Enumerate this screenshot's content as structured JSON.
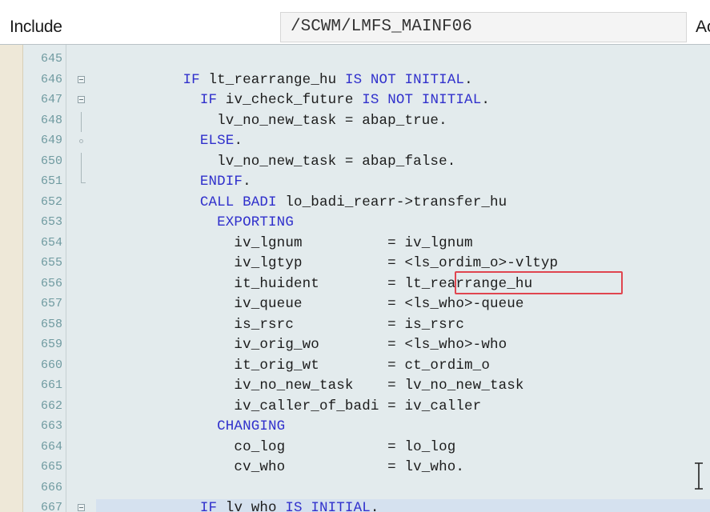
{
  "header": {
    "include_label": "Include",
    "include_value": "/SCWM/LMFS_MAINF06",
    "right_label": "Ac"
  },
  "editor": {
    "lines": [
      {
        "num": "645",
        "segs": []
      },
      {
        "num": "646",
        "fold": "box",
        "segs": [
          {
            "t": "          "
          },
          {
            "t": "IF",
            "k": 1
          },
          {
            "t": " lt_rearrange_hu "
          },
          {
            "t": "IS NOT INITIAL",
            "k": 1
          },
          {
            "t": "."
          }
        ]
      },
      {
        "num": "647",
        "fold": "box",
        "segs": [
          {
            "t": "            "
          },
          {
            "t": "IF",
            "k": 1
          },
          {
            "t": " iv_check_future "
          },
          {
            "t": "IS NOT INITIAL",
            "k": 1
          },
          {
            "t": "."
          }
        ]
      },
      {
        "num": "648",
        "fold": "line",
        "segs": [
          {
            "t": "              lv_no_new_task = abap_true."
          }
        ]
      },
      {
        "num": "649",
        "fold": "dot",
        "segs": [
          {
            "t": "            "
          },
          {
            "t": "ELSE",
            "k": 1
          },
          {
            "t": "."
          }
        ]
      },
      {
        "num": "650",
        "fold": "line",
        "segs": [
          {
            "t": "              lv_no_new_task = abap_false."
          }
        ]
      },
      {
        "num": "651",
        "fold": "end",
        "segs": [
          {
            "t": "            "
          },
          {
            "t": "ENDIF",
            "k": 1
          },
          {
            "t": "."
          }
        ]
      },
      {
        "num": "652",
        "segs": [
          {
            "t": "            "
          },
          {
            "t": "CALL BADI",
            "k": 1
          },
          {
            "t": " lo_badi_rearr->transfer_hu"
          }
        ]
      },
      {
        "num": "653",
        "segs": [
          {
            "t": "              "
          },
          {
            "t": "EXPORTING",
            "k": 1
          }
        ]
      },
      {
        "num": "654",
        "segs": [
          {
            "t": "                iv_lgnum          = iv_lgnum"
          }
        ]
      },
      {
        "num": "655",
        "segs": [
          {
            "t": "                iv_lgtyp          = <ls_ordim_o>-vltyp"
          }
        ]
      },
      {
        "num": "656",
        "segs": [
          {
            "t": "                it_huident        = lt_rearrange_hu"
          }
        ]
      },
      {
        "num": "657",
        "segs": [
          {
            "t": "                iv_queue          = <ls_who>-queue"
          }
        ]
      },
      {
        "num": "658",
        "segs": [
          {
            "t": "                is_rsrc           = is_rsrc"
          }
        ]
      },
      {
        "num": "659",
        "segs": [
          {
            "t": "                iv_orig_wo        = <ls_who>-who"
          }
        ]
      },
      {
        "num": "660",
        "segs": [
          {
            "t": "                it_orig_wt        = ct_ordim_o"
          }
        ]
      },
      {
        "num": "661",
        "segs": [
          {
            "t": "                iv_no_new_task    = lv_no_new_task"
          }
        ]
      },
      {
        "num": "662",
        "segs": [
          {
            "t": "                iv_caller_of_badi = iv_caller"
          }
        ]
      },
      {
        "num": "663",
        "segs": [
          {
            "t": "              "
          },
          {
            "t": "CHANGING",
            "k": 1
          }
        ]
      },
      {
        "num": "664",
        "segs": [
          {
            "t": "                co_log            = lo_log"
          }
        ]
      },
      {
        "num": "665",
        "segs": [
          {
            "t": "                cv_who            = lv_who."
          }
        ]
      },
      {
        "num": "666",
        "segs": []
      },
      {
        "num": "667",
        "fold": "box",
        "active": true,
        "segs": [
          {
            "t": "            "
          },
          {
            "t": "IF",
            "k": 1
          },
          {
            "t": " lv_who "
          },
          {
            "t": "IS INITIAL",
            "k": 1
          },
          {
            "t": "."
          }
        ]
      }
    ]
  },
  "colors": {
    "editor_bg": "#e3ebed",
    "keyword": "#3030cc",
    "line_number": "#6f9aa0",
    "highlight_box": "#e0454f"
  },
  "icons": {
    "cursor": "text-cursor-ibeam-icon",
    "fold": "fold-toggle-icon"
  }
}
